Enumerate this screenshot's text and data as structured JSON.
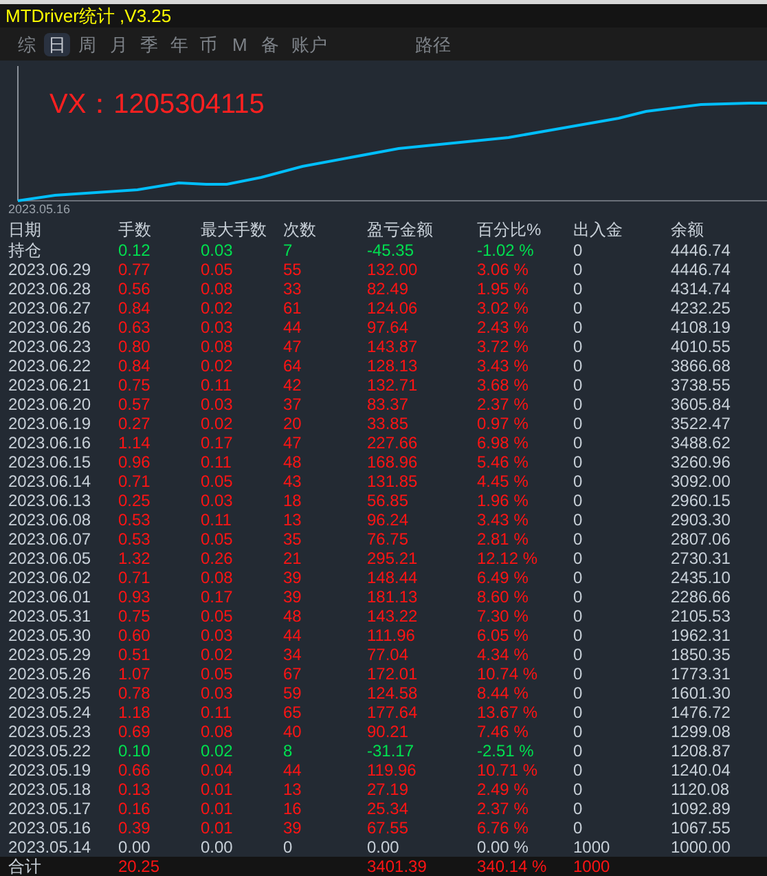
{
  "window": {
    "title": "MTDriver统计 ,V3.25"
  },
  "tabs": [
    {
      "label": "综",
      "selected": false
    },
    {
      "label": "日",
      "selected": true
    },
    {
      "label": "周",
      "selected": false
    },
    {
      "label": "月",
      "selected": false
    },
    {
      "label": "季",
      "selected": false
    },
    {
      "label": "年",
      "selected": false
    },
    {
      "label": "币",
      "selected": false
    },
    {
      "label": "M",
      "selected": false
    },
    {
      "label": "备",
      "selected": false
    },
    {
      "label": "账户",
      "selected": false
    },
    {
      "label": "路径",
      "selected": false
    }
  ],
  "chart": {
    "overlay_text": "VX：1205304115",
    "start_date": "2023.05.16"
  },
  "table": {
    "columns": [
      "日期",
      "手数",
      "最大手数",
      "次数",
      "盈亏金额",
      "百分比%",
      "出入金",
      "余额"
    ],
    "rows": [
      {
        "cells": [
          "持仓",
          "0.12",
          "0.03",
          "7",
          "-45.35",
          "-1.02 %",
          "0",
          "4446.74"
        ],
        "color": "#00e050"
      },
      {
        "cells": [
          "2023.06.29",
          "0.77",
          "0.05",
          "55",
          "132.00",
          "3.06 %",
          "0",
          "4446.74"
        ],
        "color": "#ff1414"
      },
      {
        "cells": [
          "2023.06.28",
          "0.56",
          "0.08",
          "33",
          "82.49",
          "1.95 %",
          "0",
          "4314.74"
        ],
        "color": "#ff1414"
      },
      {
        "cells": [
          "2023.06.27",
          "0.84",
          "0.02",
          "61",
          "124.06",
          "3.02 %",
          "0",
          "4232.25"
        ],
        "color": "#ff1414"
      },
      {
        "cells": [
          "2023.06.26",
          "0.63",
          "0.03",
          "44",
          "97.64",
          "2.43 %",
          "0",
          "4108.19"
        ],
        "color": "#ff1414"
      },
      {
        "cells": [
          "2023.06.23",
          "0.80",
          "0.08",
          "47",
          "143.87",
          "3.72 %",
          "0",
          "4010.55"
        ],
        "color": "#ff1414"
      },
      {
        "cells": [
          "2023.06.22",
          "0.84",
          "0.02",
          "64",
          "128.13",
          "3.43 %",
          "0",
          "3866.68"
        ],
        "color": "#ff1414"
      },
      {
        "cells": [
          "2023.06.21",
          "0.75",
          "0.11",
          "42",
          "132.71",
          "3.68 %",
          "0",
          "3738.55"
        ],
        "color": "#ff1414"
      },
      {
        "cells": [
          "2023.06.20",
          "0.57",
          "0.03",
          "37",
          "83.37",
          "2.37 %",
          "0",
          "3605.84"
        ],
        "color": "#ff1414"
      },
      {
        "cells": [
          "2023.06.19",
          "0.27",
          "0.02",
          "20",
          "33.85",
          "0.97 %",
          "0",
          "3522.47"
        ],
        "color": "#ff1414"
      },
      {
        "cells": [
          "2023.06.16",
          "1.14",
          "0.17",
          "47",
          "227.66",
          "6.98 %",
          "0",
          "3488.62"
        ],
        "color": "#ff1414"
      },
      {
        "cells": [
          "2023.06.15",
          "0.96",
          "0.11",
          "48",
          "168.96",
          "5.46 %",
          "0",
          "3260.96"
        ],
        "color": "#ff1414"
      },
      {
        "cells": [
          "2023.06.14",
          "0.71",
          "0.05",
          "43",
          "131.85",
          "4.45 %",
          "0",
          "3092.00"
        ],
        "color": "#ff1414"
      },
      {
        "cells": [
          "2023.06.13",
          "0.25",
          "0.03",
          "18",
          "56.85",
          "1.96 %",
          "0",
          "2960.15"
        ],
        "color": "#ff1414"
      },
      {
        "cells": [
          "2023.06.08",
          "0.53",
          "0.11",
          "13",
          "96.24",
          "3.43 %",
          "0",
          "2903.30"
        ],
        "color": "#ff1414"
      },
      {
        "cells": [
          "2023.06.07",
          "0.53",
          "0.05",
          "35",
          "76.75",
          "2.81 %",
          "0",
          "2807.06"
        ],
        "color": "#ff1414"
      },
      {
        "cells": [
          "2023.06.05",
          "1.32",
          "0.26",
          "21",
          "295.21",
          "12.12 %",
          "0",
          "2730.31"
        ],
        "color": "#ff1414"
      },
      {
        "cells": [
          "2023.06.02",
          "0.71",
          "0.08",
          "39",
          "148.44",
          "6.49 %",
          "0",
          "2435.10"
        ],
        "color": "#ff1414"
      },
      {
        "cells": [
          "2023.06.01",
          "0.93",
          "0.17",
          "39",
          "181.13",
          "8.60 %",
          "0",
          "2286.66"
        ],
        "color": "#ff1414"
      },
      {
        "cells": [
          "2023.05.31",
          "0.75",
          "0.05",
          "48",
          "143.22",
          "7.30 %",
          "0",
          "2105.53"
        ],
        "color": "#ff1414"
      },
      {
        "cells": [
          "2023.05.30",
          "0.60",
          "0.03",
          "44",
          "111.96",
          "6.05 %",
          "0",
          "1962.31"
        ],
        "color": "#ff1414"
      },
      {
        "cells": [
          "2023.05.29",
          "0.51",
          "0.02",
          "34",
          "77.04",
          "4.34 %",
          "0",
          "1850.35"
        ],
        "color": "#ff1414"
      },
      {
        "cells": [
          "2023.05.26",
          "1.07",
          "0.05",
          "67",
          "172.01",
          "10.74 %",
          "0",
          "1773.31"
        ],
        "color": "#ff1414"
      },
      {
        "cells": [
          "2023.05.25",
          "0.78",
          "0.03",
          "59",
          "124.58",
          "8.44 %",
          "0",
          "1601.30"
        ],
        "color": "#ff1414"
      },
      {
        "cells": [
          "2023.05.24",
          "1.18",
          "0.11",
          "65",
          "177.64",
          "13.67 %",
          "0",
          "1476.72"
        ],
        "color": "#ff1414"
      },
      {
        "cells": [
          "2023.05.23",
          "0.69",
          "0.08",
          "40",
          "90.21",
          "7.46 %",
          "0",
          "1299.08"
        ],
        "color": "#ff1414"
      },
      {
        "cells": [
          "2023.05.22",
          "0.10",
          "0.02",
          "8",
          "-31.17",
          "-2.51 %",
          "0",
          "1208.87"
        ],
        "color": "#00e050"
      },
      {
        "cells": [
          "2023.05.19",
          "0.66",
          "0.04",
          "44",
          "119.96",
          "10.71 %",
          "0",
          "1240.04"
        ],
        "color": "#ff1414"
      },
      {
        "cells": [
          "2023.05.18",
          "0.13",
          "0.01",
          "13",
          "27.19",
          "2.49 %",
          "0",
          "1120.08"
        ],
        "color": "#ff1414"
      },
      {
        "cells": [
          "2023.05.17",
          "0.16",
          "0.01",
          "16",
          "25.34",
          "2.37 %",
          "0",
          "1092.89"
        ],
        "color": "#ff1414"
      },
      {
        "cells": [
          "2023.05.16",
          "0.39",
          "0.01",
          "39",
          "67.55",
          "6.76 %",
          "0",
          "1067.55"
        ],
        "color": "#ff1414"
      },
      {
        "cells": [
          "2023.05.14",
          "0.00",
          "0.00",
          "0",
          "0.00",
          "0.00 %",
          "1000",
          "1000.00"
        ],
        "color": "#c8d0d8"
      }
    ],
    "total": {
      "label": "合计",
      "cells": [
        "20.25",
        "",
        "",
        "3401.39",
        "340.14 %",
        "1000"
      ]
    }
  }
}
